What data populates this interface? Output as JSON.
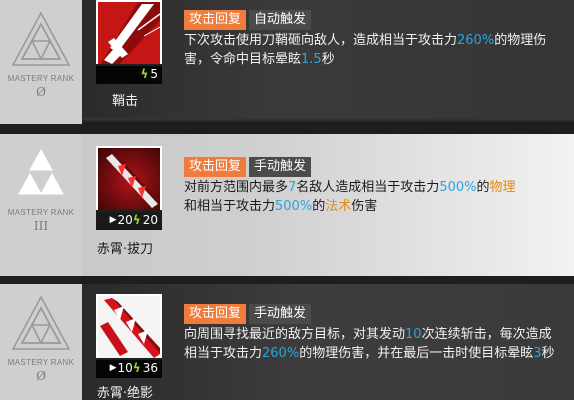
{
  "colors": {
    "tag_recovery": "#f07c3c",
    "tag_trigger": "#4b4b4b",
    "highlight_blue": "#27a6e0",
    "highlight_orange": "#e38a12",
    "sp_bolt": "#8fdb2a"
  },
  "skills": [
    {
      "mastery_label": "MASTERY RANK",
      "mastery_value": "Ø",
      "name": "鞘击",
      "icon": "sheath-strike-icon",
      "cost": "5",
      "tag_recovery": "攻击回复",
      "tag_trigger": "自动触发",
      "desc": {
        "t1": "下次攻击使用刀鞘砸向敌人，造成相当于攻击力",
        "v1": "260%",
        "t2": "的物理伤害，令命中目标晕眩",
        "v2": "1.5",
        "t3": "秒"
      }
    },
    {
      "mastery_label": "MASTERY RANK",
      "mastery_value": "III",
      "name": "赤霄·拔刀",
      "icon": "crimson-blade-draw-icon",
      "initial_sp": "20",
      "cost": "20",
      "tag_recovery": "攻击回复",
      "tag_trigger": "手动触发",
      "desc": {
        "t1": "对前方范围内最多",
        "v1": "7",
        "t2": "名敌人造成相当于攻击力",
        "v2": "500%",
        "t3": "的",
        "o1": "物理",
        "t4": "和相当于攻击力",
        "v3": "500%",
        "t5": "的",
        "o2": "法术",
        "t6": "伤害"
      }
    },
    {
      "mastery_label": "MASTERY RANK",
      "mastery_value": "Ø",
      "name": "赤霄·绝影",
      "icon": "crimson-shadow-icon",
      "initial_sp": "10",
      "cost": "36",
      "tag_recovery": "攻击回复",
      "tag_trigger": "手动触发",
      "desc": {
        "t1": "向周围寻找最近的敌方目标，对其发动",
        "v1": "10",
        "t2": "次连续斩击，每次造成相当于攻击力",
        "v2": "260%",
        "t3": "的物理伤害，并在最后一击时使目标晕眩",
        "v3": "3",
        "t4": "秒"
      }
    }
  ]
}
